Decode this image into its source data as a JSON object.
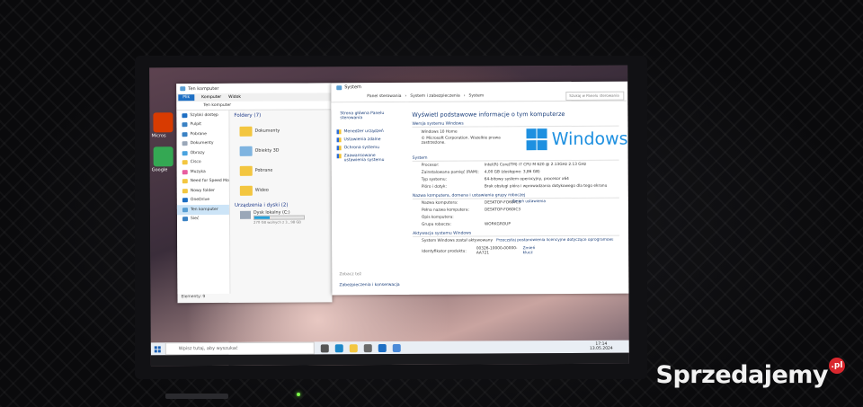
{
  "watermark": {
    "brand": "Sprzedajemy",
    "suffix": ".pl"
  },
  "desktop_icons": [
    {
      "label": "Micros",
      "color": "#d83b01"
    },
    {
      "label": "Google",
      "color": "#34a853"
    }
  ],
  "explorer": {
    "title": "Ten komputer",
    "ribbon": [
      "Plik",
      "Komputer",
      "Widok"
    ],
    "address": "Ten komputer",
    "nav": [
      {
        "label": "Szybki dostęp",
        "color": "#1e6fc4",
        "selected": false
      },
      {
        "label": "Pulpit",
        "color": "#3b82c4",
        "selected": false
      },
      {
        "label": "Pobrane",
        "color": "#3b82c4",
        "selected": false
      },
      {
        "label": "Dokumenty",
        "color": "#9aa7b8",
        "selected": false
      },
      {
        "label": "Obrazy",
        "color": "#4aa3df",
        "selected": false
      },
      {
        "label": "Cisco",
        "color": "#f3c640",
        "selected": false
      },
      {
        "label": "Muzyka",
        "color": "#e85d9f",
        "selected": false
      },
      {
        "label": "Need for Speed Mo",
        "color": "#f3c640",
        "selected": false
      },
      {
        "label": "Nowy folder",
        "color": "#f3c640",
        "selected": false
      },
      {
        "label": "OneDrive",
        "color": "#1e6fc4",
        "selected": false
      },
      {
        "label": "Ten komputer",
        "color": "#5a9fd4",
        "selected": true
      },
      {
        "label": "Sieć",
        "color": "#3b82c4",
        "selected": false
      }
    ],
    "folders_header": "Foldery (7)",
    "folders": [
      "Dokumenty",
      "Obiekty 3D",
      "Pobrane",
      "Wideo"
    ],
    "devices_header": "Urządzenia i dyski (2)",
    "drive_label": "Dysk lokalny (C:)",
    "drive_free": "270 GB wolnych z 3...98 GB",
    "drive_fill": 0.3,
    "status": "Elementy: 9"
  },
  "system": {
    "title": "System",
    "breadcrumb": [
      "Panel sterowania",
      "System i zabezpieczenia",
      "System"
    ],
    "search_placeholder": "Szukaj w Panelu sterowania",
    "home_link": "Strona główna Panelu sterowania",
    "left_links": [
      "Menedżer urządzeń",
      "Ustawienia zdalne",
      "Ochrona systemu",
      "Zaawansowane ustawienia systemu"
    ],
    "see_also": "Zobacz też",
    "security_link": "Zabezpieczenia i konserwacja",
    "heading": "Wyświetl podstawowe informacje o tym komputerze",
    "edition_section": "Wersja systemu Windows",
    "edition": "Windows 10 Home",
    "copyright": "© Microsoft Corporation. Wszelkie prawa zastrzeżone.",
    "windows_logo_text": "Windows",
    "system_section": "System",
    "system_rows": [
      {
        "k": "Procesor:",
        "v": "Intel(R) Core(TM) i7 CPU       M 620  @ 2.13GHz   2.13 GHz"
      },
      {
        "k": "Zainstalowana pamięć (RAM):",
        "v": "4,00 GB (dostępne: 3,86 GB)"
      },
      {
        "k": "Typ systemu:",
        "v": "64-bitowy system operacyjny, procesor x64"
      },
      {
        "k": "Pióro i dotyk:",
        "v": "Brak obsługi pióra i wprowadzania dotykowego dla tego ekranu"
      }
    ],
    "name_section": "Nazwa komputera, domena i ustawienia grupy roboczej",
    "name_rows": [
      {
        "k": "Nazwa komputera:",
        "v": "DESKTOP-FO6DIC3"
      },
      {
        "k": "Pełna nazwa komputera:",
        "v": "DESKTOP-FO6DIC3"
      },
      {
        "k": "Opis komputera:",
        "v": ""
      },
      {
        "k": "Grupa robocza:",
        "v": "WORKGROUP"
      }
    ],
    "change_settings": "Zmień ustawienia",
    "activation_section": "Aktywacja systemu Windows",
    "activation_text": "System Windows został aktywowany",
    "license_link": "Przeczytaj postanowienia licencyjne dotyczące oprogramowania firmy Microsoft",
    "product_id_label": "Identyfikator produktu:",
    "product_id": "00326-10000-00000-AA721",
    "change_key": "Zmień klucz"
  },
  "taskbar": {
    "search_placeholder": "Wpisz tutaj, aby wyszukać",
    "time": "17:14",
    "date": "13.05.2024",
    "icons": [
      {
        "name": "task-view-icon",
        "color": "#555"
      },
      {
        "name": "edge-icon",
        "color": "#1e88c8"
      },
      {
        "name": "file-explorer-icon",
        "color": "#f3c640"
      },
      {
        "name": "store-icon",
        "color": "#6a6a6a"
      },
      {
        "name": "mail-icon",
        "color": "#1e6fc4"
      },
      {
        "name": "settings-icon",
        "color": "#4a8ad8"
      }
    ]
  }
}
